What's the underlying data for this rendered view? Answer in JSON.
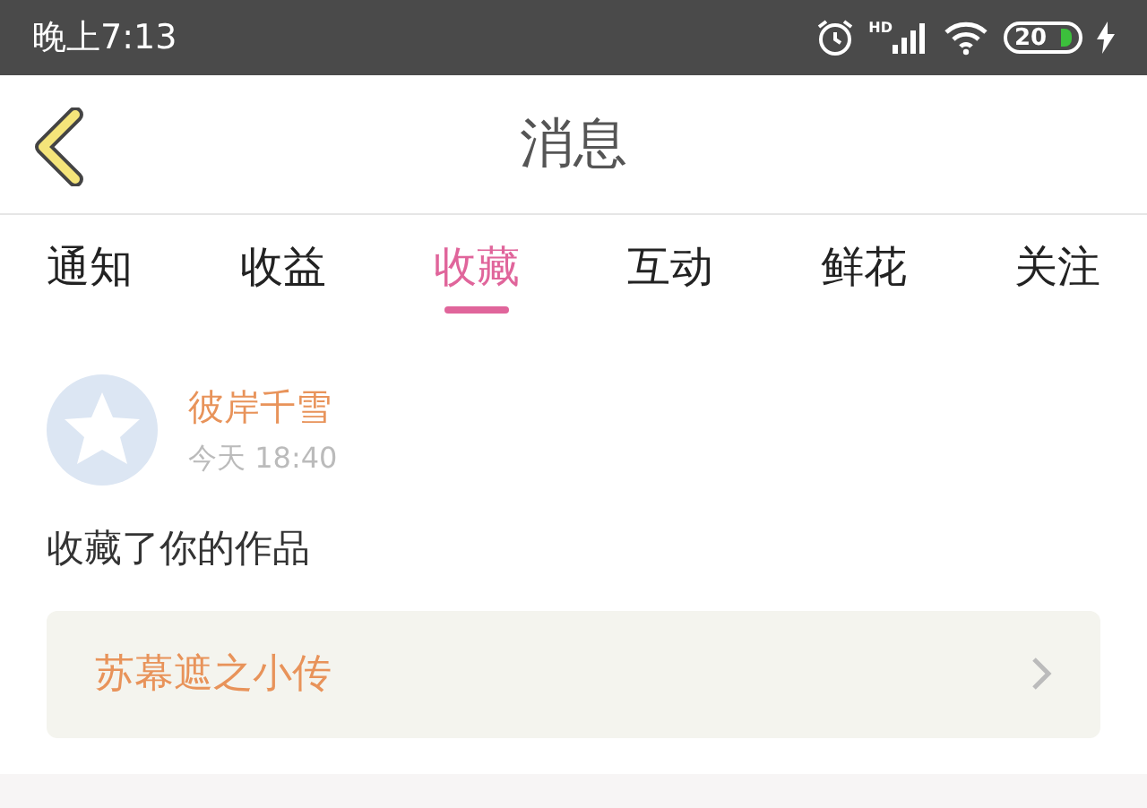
{
  "status_bar": {
    "time": "晚上7:13",
    "network_label": "HD",
    "battery_text": "20"
  },
  "header": {
    "title": "消息"
  },
  "tabs": [
    {
      "label": "通知",
      "selected": false
    },
    {
      "label": "收益",
      "selected": false
    },
    {
      "label": "收藏",
      "selected": true
    },
    {
      "label": "互动",
      "selected": false
    },
    {
      "label": "鲜花",
      "selected": false
    },
    {
      "label": "关注",
      "selected": false
    }
  ],
  "messages": [
    {
      "user": "彼岸千雪",
      "time": "今天 18:40",
      "text": "收藏了你的作品",
      "work_title": "苏幕遮之小传"
    }
  ]
}
